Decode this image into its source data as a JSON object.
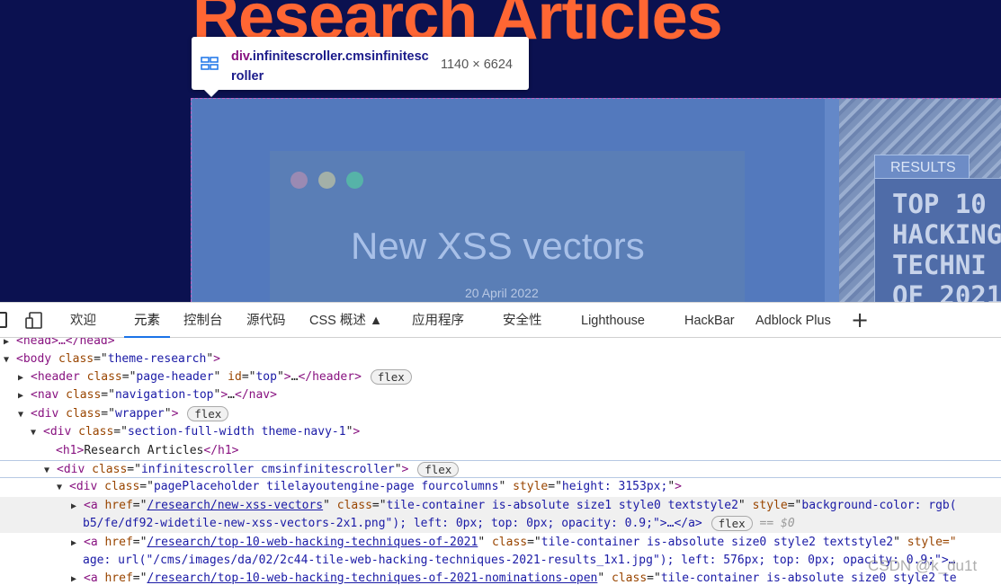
{
  "page": {
    "heading": "Research Articles",
    "tile1": {
      "title": "New XSS vectors",
      "date": "20 April 2022"
    },
    "tile2": {
      "badge": "RESULTS",
      "title": "TOP 10\nHACKING\nTECHNI\nOF 2021"
    }
  },
  "tooltip": {
    "tag": "div",
    "classes": ".infinitescroller.cmsinfinitescroller",
    "size": "1140 × 6624"
  },
  "devtools": {
    "tabs": [
      {
        "label": "欢迎"
      },
      {
        "label": "元素"
      },
      {
        "label": "控制台"
      },
      {
        "label": "源代码"
      },
      {
        "label": "CSS 概述 ▲"
      },
      {
        "label": "应用程序"
      },
      {
        "label": "安全性"
      },
      {
        "label": "Lighthouse"
      },
      {
        "label": "HackBar"
      },
      {
        "label": "Adblock Plus"
      }
    ],
    "active_tab": "元素",
    "add_tab": "+"
  },
  "dom": {
    "head": "<head>…</head>",
    "body_open": {
      "tag": "body",
      "class": "theme-research"
    },
    "header": {
      "class": "page-header",
      "id": "top",
      "badge": "flex"
    },
    "nav": {
      "class": "navigation-top"
    },
    "wrapper": {
      "class": "wrapper",
      "badge": "flex"
    },
    "section": {
      "class": "section-full-width theme-navy-1"
    },
    "h1_text": "Research Articles",
    "scroller": {
      "class": "infinitescroller cmsinfinitescroller",
      "badge": "flex"
    },
    "placeholder": {
      "class": "pagePlaceholder tilelayoutengine-page fourcolumns",
      "style": "height: 3153px;"
    },
    "a1": {
      "href": "/research/new-xss-vectors",
      "class": "tile-container is-absolute size1 style0 textstyle2",
      "style_start": "background-color: rgb(",
      "line2": "b5/fe/df92-widetile-new-xss-vectors-2x1.png\"); left: 0px; top: 0px; opacity: 0.9;\">…</a>",
      "badge": "flex",
      "eq": "== $0"
    },
    "a2": {
      "href": "/research/top-10-web-hacking-techniques-of-2021",
      "class": "tile-container is-absolute size0 style2 textstyle2",
      "style_start": "style=\"",
      "line2": "age: url(\"/cms/images/da/02/2c44-tile-web-hacking-techniques-2021-results_1x1.jpg\"); left: 576px; top: 0px; opacity: 0.9;\">…"
    },
    "a3": {
      "href": "/research/top-10-web-hacking-techniques-of-2021-nominations-open",
      "class": "tile-container is-absolute size0 style2 te"
    }
  },
  "watermark": "CSDN @k_du1t"
}
